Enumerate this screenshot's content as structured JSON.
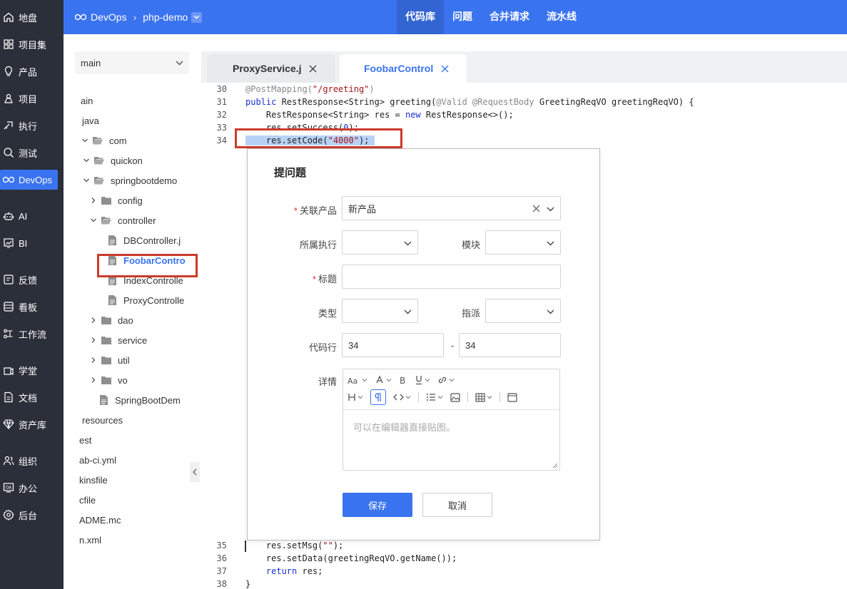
{
  "nav": {
    "items": [
      {
        "label": "地盘",
        "icon": "home-icon"
      },
      {
        "label": "项目集",
        "icon": "grid-icon"
      },
      {
        "label": "产品",
        "icon": "bulb-icon"
      },
      {
        "label": "项目",
        "icon": "project-icon"
      },
      {
        "label": "执行",
        "icon": "run-icon"
      },
      {
        "label": "测试",
        "icon": "test-icon"
      },
      {
        "label": "DevOps",
        "icon": "infinity-icon",
        "active": true
      },
      {
        "label": "AI",
        "icon": "robot-icon"
      },
      {
        "label": "BI",
        "icon": "chart-icon"
      },
      {
        "label": "反馈",
        "icon": "feedback-icon"
      },
      {
        "label": "看板",
        "icon": "board-icon"
      },
      {
        "label": "工作流",
        "icon": "workflow-icon"
      },
      {
        "label": "学堂",
        "icon": "school-icon"
      },
      {
        "label": "文档",
        "icon": "doc-icon"
      },
      {
        "label": "资产库",
        "icon": "diamond-icon"
      },
      {
        "label": "组织",
        "icon": "people-icon"
      },
      {
        "label": "办公",
        "icon": "oa-icon"
      },
      {
        "label": "后台",
        "icon": "settings-icon"
      }
    ]
  },
  "topbar": {
    "breadcrumb_root": "DevOps",
    "breadcrumb_repo": "php-demo",
    "tabs": [
      {
        "label": "代码库",
        "active": true
      },
      {
        "label": "问题"
      },
      {
        "label": "合并请求"
      },
      {
        "label": "流水线"
      }
    ]
  },
  "tree": {
    "branch": "main",
    "rows": [
      {
        "label": "ain",
        "type": "none"
      },
      {
        "label": "java",
        "type": "none"
      },
      {
        "label": "com",
        "type": "folder-open"
      },
      {
        "label": "quickon",
        "type": "folder-open"
      },
      {
        "label": "springbootdemo",
        "type": "folder-open"
      },
      {
        "label": "config",
        "type": "folder"
      },
      {
        "label": "controller",
        "type": "folder-open"
      },
      {
        "label": "DBController.j",
        "type": "file"
      },
      {
        "label": "FoobarContro",
        "type": "file",
        "selected": true
      },
      {
        "label": "IndexControlle",
        "type": "file"
      },
      {
        "label": "ProxyControlle",
        "type": "file"
      },
      {
        "label": "dao",
        "type": "folder"
      },
      {
        "label": "service",
        "type": "folder"
      },
      {
        "label": "util",
        "type": "folder"
      },
      {
        "label": "vo",
        "type": "folder"
      },
      {
        "label": "SpringBootDem",
        "type": "file"
      },
      {
        "label": "resources",
        "type": "none"
      },
      {
        "label": "est",
        "type": "none"
      },
      {
        "label": "ab-ci.yml",
        "type": "none"
      },
      {
        "label": "kinsfile",
        "type": "none"
      },
      {
        "label": "cfile",
        "type": "none"
      },
      {
        "label": "ADME.mc",
        "type": "none"
      },
      {
        "label": "n.xml",
        "type": "none"
      }
    ]
  },
  "editor_tabs": [
    {
      "label": "ProxyService.j",
      "active": false
    },
    {
      "label": "FoobarControl",
      "active": true
    }
  ],
  "code": {
    "lines_top": [
      {
        "num": "30",
        "parts": [
          {
            "t": "@PostMapping(",
            "c": "ann"
          },
          {
            "t": "\"/greeting\"",
            "c": "str"
          },
          {
            "t": ")",
            "c": "ann"
          }
        ]
      },
      {
        "num": "31",
        "parts": [
          {
            "t": "public ",
            "c": "kw"
          },
          {
            "t": "RestResponse<String> greeting(",
            "c": ""
          },
          {
            "t": "@Valid @RequestBody ",
            "c": "ann"
          },
          {
            "t": "GreetingReqVO greetingReqVO) {",
            "c": ""
          }
        ]
      },
      {
        "num": "32",
        "parts": [
          {
            "t": "    RestResponse<String> res = ",
            "c": ""
          },
          {
            "t": "new ",
            "c": "kw"
          },
          {
            "t": "RestResponse<>();",
            "c": ""
          }
        ]
      },
      {
        "num": "33",
        "parts": [
          {
            "t": "    res.setSuccess(",
            "c": ""
          },
          {
            "t": "0",
            "c": "kw"
          },
          {
            "t": ");",
            "c": ""
          }
        ]
      },
      {
        "num": "34",
        "parts": [
          {
            "t": "    res.setCode(",
            "c": ""
          },
          {
            "t": "\"4000\"",
            "c": "str"
          },
          {
            "t": ");",
            "c": ""
          }
        ],
        "selected": true
      }
    ],
    "lines_bottom": [
      {
        "num": "35",
        "parts": [
          {
            "t": "    res.setMsg(",
            "c": ""
          },
          {
            "t": "\"\"",
            "c": "str"
          },
          {
            "t": ");",
            "c": ""
          }
        ]
      },
      {
        "num": "36",
        "parts": [
          {
            "t": "    res.setData(greetingReqVO.getName());",
            "c": ""
          }
        ]
      },
      {
        "num": "37",
        "parts": [
          {
            "t": "    ",
            "c": ""
          },
          {
            "t": "return ",
            "c": "kw"
          },
          {
            "t": "res;",
            "c": ""
          }
        ]
      },
      {
        "num": "38",
        "parts": [
          {
            "t": "}",
            "c": ""
          }
        ]
      }
    ]
  },
  "dialog": {
    "title": "提问题",
    "product_label": "关联产品",
    "product_value": "新产品",
    "execution_label": "所属执行",
    "module_label": "模块",
    "title_label": "标题",
    "type_label": "类型",
    "assign_label": "指派",
    "code_line_label": "代码行",
    "line_from": "34",
    "line_to": "34",
    "line_dash": "-",
    "detail_label": "详情",
    "editor_placeholder": "可以在编辑器直接贴图。",
    "save": "保存",
    "cancel": "取消"
  },
  "colors": {
    "primary": "#3a73f0",
    "sidebar": "#2b2f3a",
    "highlight": "#cc3b2a"
  }
}
